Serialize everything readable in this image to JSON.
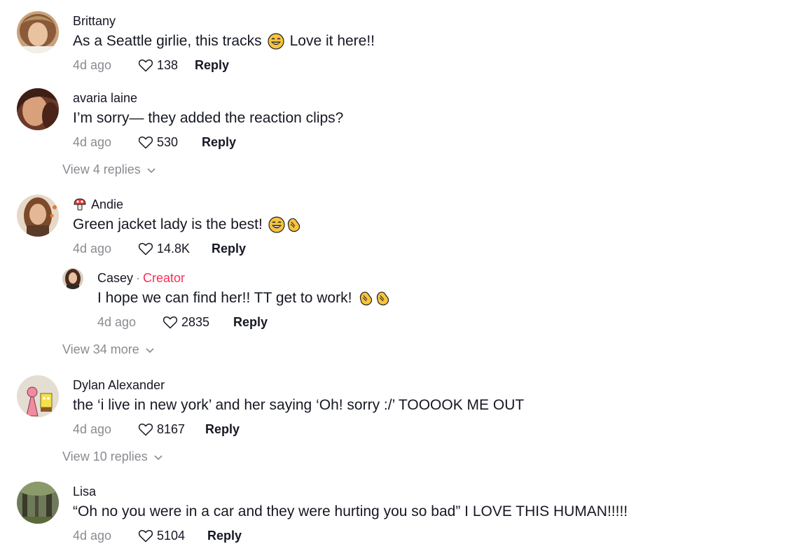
{
  "comments": [
    {
      "username": "Brittany",
      "text_before": "As a Seattle girlie, this tracks",
      "text_after": "Love it here!!",
      "time": "4d ago",
      "likes": "138",
      "reply_label": "Reply"
    },
    {
      "username": "avaria laine",
      "text": "I’m sorry— they added the reaction clips?",
      "time": "4d ago",
      "likes": "530",
      "reply_label": "Reply",
      "view_more": "View 4 replies"
    },
    {
      "username": "Andie",
      "text": "Green jacket lady is the best!",
      "time": "4d ago",
      "likes": "14.8K",
      "reply_label": "Reply",
      "reply": {
        "username": "Casey",
        "dot": "·",
        "creator_tag": "Creator",
        "text": "I hope we can find her!! TT get to work!",
        "time": "4d ago",
        "likes": "2835",
        "reply_label": "Reply"
      },
      "view_more": "View 34 more"
    },
    {
      "username": "Dylan Alexander",
      "text": "the ‘i live in new york’ and her saying ‘Oh! sorry :/’ TOOOOK ME OUT",
      "time": "4d ago",
      "likes": "8167",
      "reply_label": "Reply",
      "view_more": "View 10 replies"
    },
    {
      "username": "Lisa",
      "text": "“Oh no you were in a car and they were hurting you so bad” I LOVE THIS HUMAN!!!!!",
      "time": "4d ago",
      "likes": "5104",
      "reply_label": "Reply"
    }
  ],
  "colors": {
    "text": "#161823",
    "muted": "#8a8b91",
    "creator": "#fe2c55"
  },
  "icons": {
    "like": "heart-outline-icon",
    "expand": "chevron-down-icon",
    "emoji_laugh": "tears-of-joy-emoji-icon",
    "emoji_clap": "clapping-hands-emoji-icon",
    "badge": "mushroom-icon"
  }
}
